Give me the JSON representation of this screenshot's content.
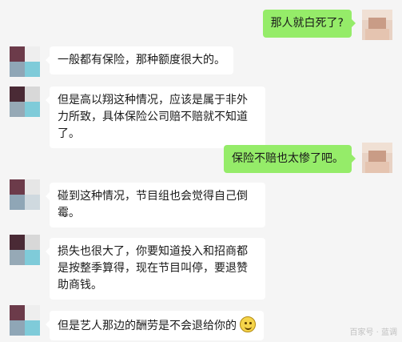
{
  "messages": [
    {
      "side": "out",
      "text": "那人就白死了?"
    },
    {
      "side": "in",
      "text": "一般都有保险，那种额度很大的。"
    },
    {
      "side": "in",
      "text": "但是高以翔这种情况，应该是属于非外力所致，具体保险公司赔不赔就不知道了。"
    },
    {
      "side": "out",
      "text": "保险不赔也太惨了吧。"
    },
    {
      "side": "in",
      "text": "碰到这种情况，节目组也会觉得自己倒霉。"
    },
    {
      "side": "in",
      "text": "损失也很大了，你要知道投入和招商都是按整季算得，现在节目叫停，要退赞助商钱。"
    },
    {
      "side": "in",
      "text": "但是艺人那边的酬劳是不会退给你的",
      "emoji": "smile-emoji-icon"
    }
  ],
  "colors": {
    "background": "#f5f5f5",
    "bubble_in": "#ffffff",
    "bubble_out": "#95ec69",
    "text": "#1a1a1a"
  },
  "watermark": "百家号 · 蓝调"
}
